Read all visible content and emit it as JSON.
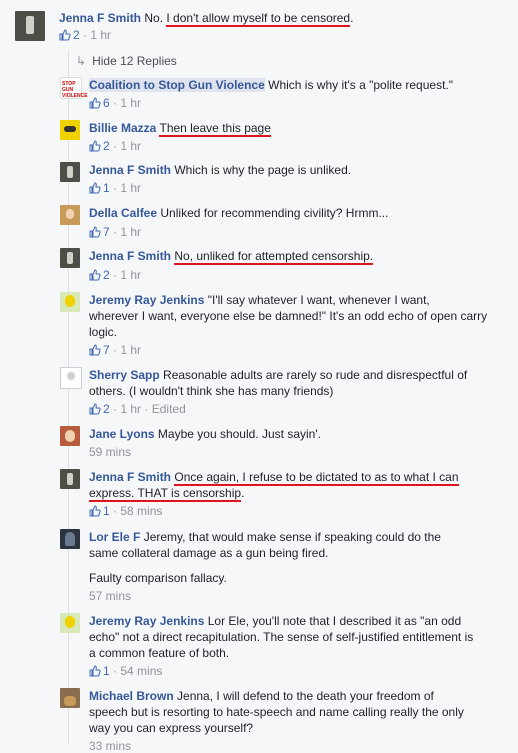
{
  "top_comment": {
    "name": "Jenna F Smith",
    "pre": "No. ",
    "underlined": "I don't allow myself to be censored",
    "post": ".",
    "likes": "2",
    "time": "1 hr"
  },
  "hide_replies": "Hide 12 Replies",
  "replies": [
    {
      "name": "Coalition to Stop Gun Violence",
      "text": "Which is why it's a \"polite request.\"",
      "likes": "6",
      "time": "1 hr",
      "avatar_label": "STOP GUN VIOLENCE"
    },
    {
      "name": "Billie Mazza",
      "underlined": "Then leave this page",
      "likes": "2",
      "time": "1 hr"
    },
    {
      "name": "Jenna F Smith",
      "text": "Which is why the page is unliked.",
      "likes": "1",
      "time": "1 hr"
    },
    {
      "name": "Della Calfee",
      "text": "Unliked for recommending civility? Hrmm...",
      "likes": "7",
      "time": "1 hr"
    },
    {
      "name": "Jenna F Smith",
      "underlined": "No, unliked for attempted censorship.",
      "likes": "2",
      "time": "1 hr"
    },
    {
      "name": "Jeremy Ray Jenkins",
      "line1": "\"I'll say whatever I want, whenever I want,",
      "line2": "wherever I want, everyone else be damned!\" It's an odd echo of open carry",
      "line3": "logic.",
      "likes": "7",
      "time": "1 hr"
    },
    {
      "name": "Sherry Sapp",
      "line1": "Reasonable adults are rarely so rude and disrespectful of",
      "line2": "others. (I wouldn't think she has many friends)",
      "likes": "2",
      "time": "1 hr",
      "edited": "Edited"
    },
    {
      "name": "Jane Lyons",
      "text": "Maybe you should. Just sayin'.",
      "time": "59 mins"
    },
    {
      "name": "Jenna F Smith",
      "ul1": "Once again, I refuse to be dictated to as to what I can",
      "ul2a": "express. THAT is censorship",
      "ul2b": ".",
      "likes": "1",
      "time": "58 mins"
    },
    {
      "name": "Lor Ele F",
      "line1": "Jeremy, that would make sense if speaking could do the",
      "line2": "same collateral damage as a gun being fired.",
      "line3": "Faulty comparison fallacy.",
      "time": "57 mins"
    },
    {
      "name": "Jeremy Ray Jenkins",
      "line1": "Lor Ele, you'll note that I described it as \"an odd",
      "line2": "echo\" not a direct recapitulation. The sense of self-justified entitlement is",
      "line3": "a common feature of both.",
      "likes": "1",
      "time": "54 mins"
    },
    {
      "name": "Michael Brown",
      "line1": "Jenna, I will defend to the death your freedom of",
      "line2": "speech but is resorting to hate-speech and name calling really the only",
      "line3": "way you can express yourself?",
      "time": "33 mins"
    }
  ],
  "sep": "·",
  "colors": {
    "link": "#365899",
    "underline": "#e0141e",
    "meta": "#90949c",
    "like": "#4267b2"
  }
}
